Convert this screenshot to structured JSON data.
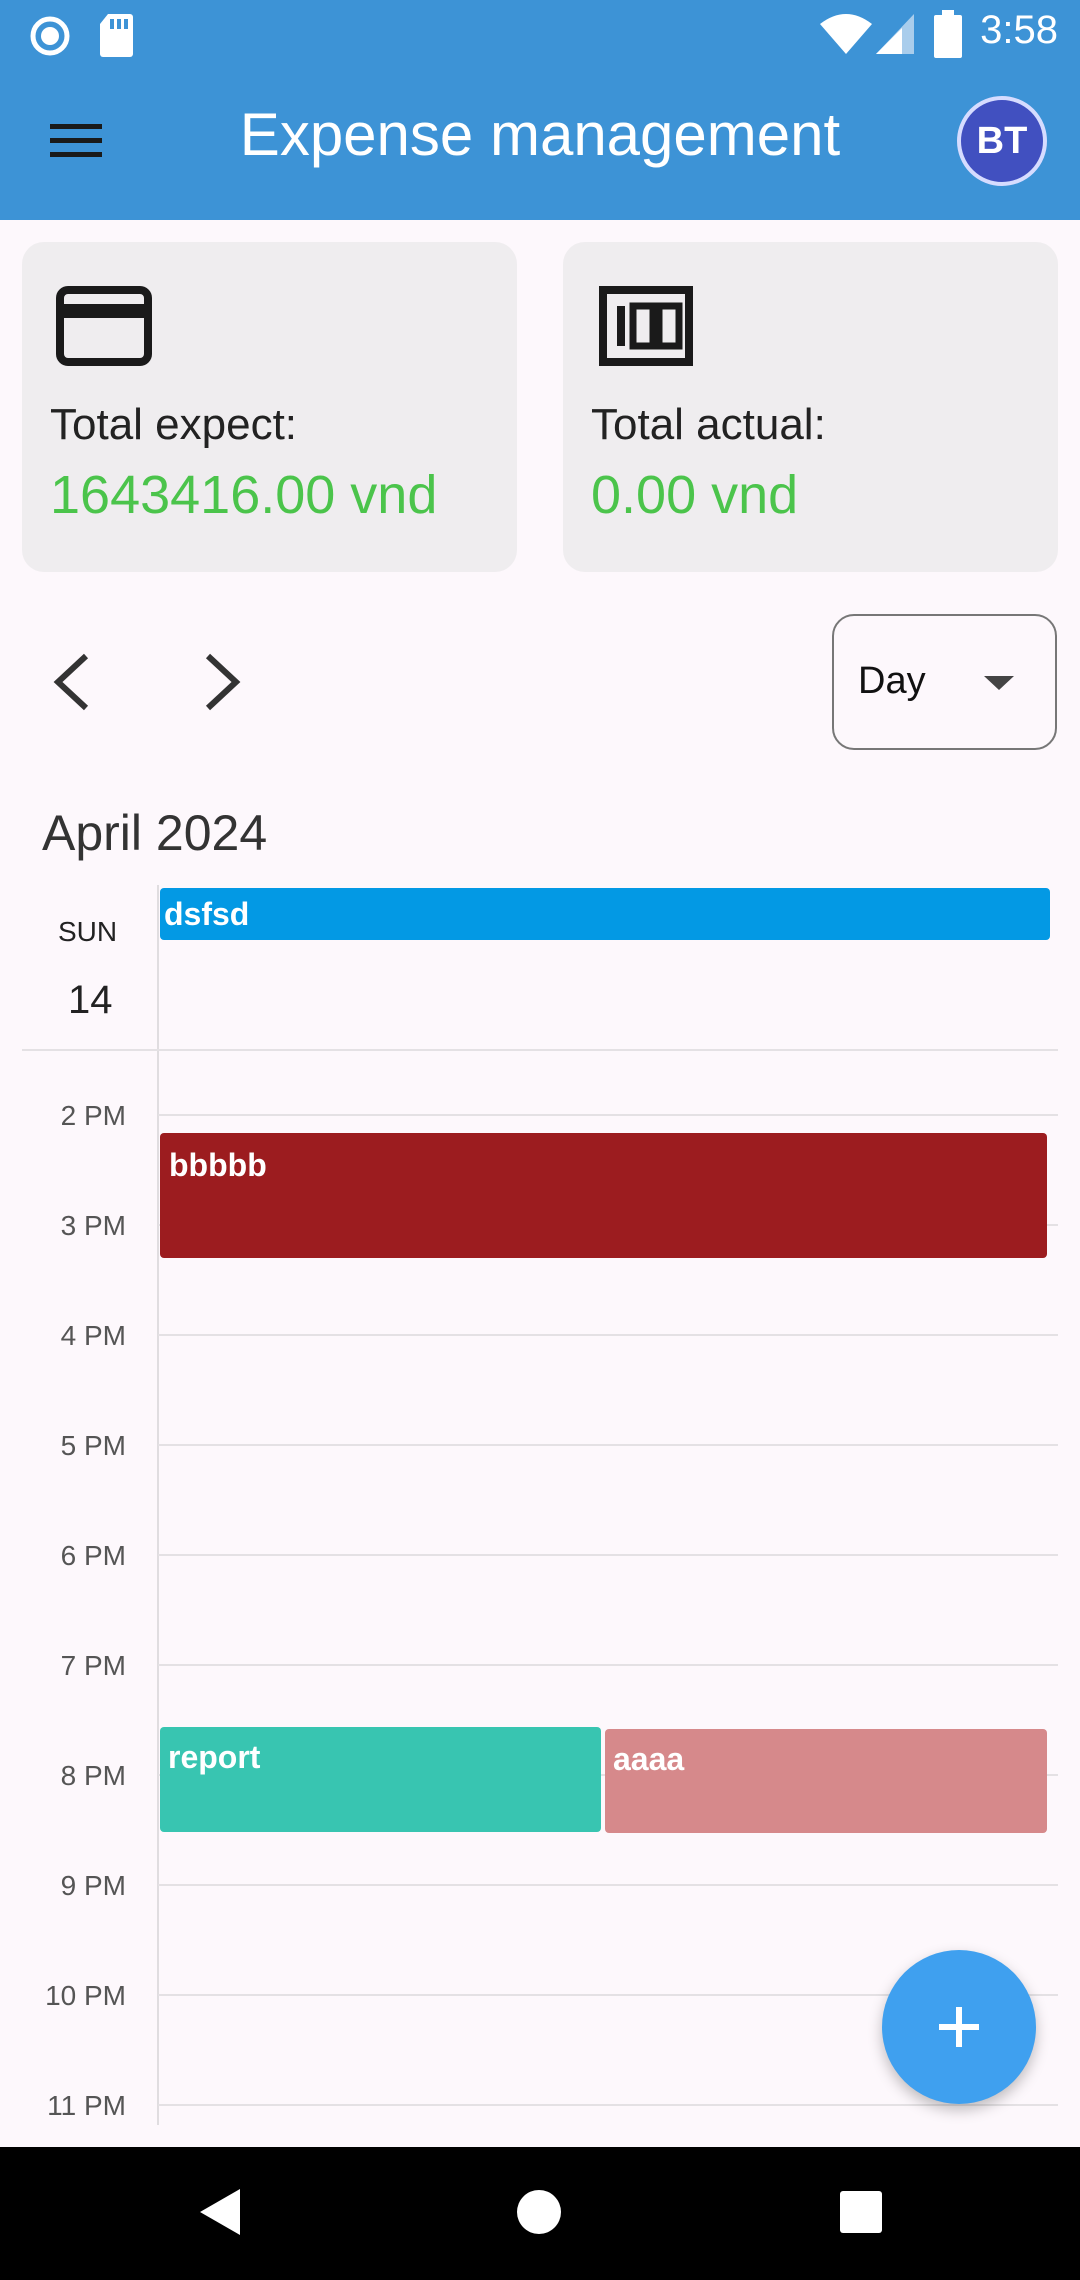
{
  "status_bar": {
    "time": "3:58"
  },
  "app_bar": {
    "title": "Expense management",
    "avatar_initials": "BT"
  },
  "summary": {
    "expect": {
      "label": "Total expect:",
      "value": "1643416.00 vnd",
      "icon": "credit-card-icon"
    },
    "actual": {
      "label": "Total actual:",
      "value": "0.00 vnd",
      "icon": "money-100-icon"
    },
    "value_color": "#4bc44b"
  },
  "view_selector": {
    "selected": "Day"
  },
  "calendar": {
    "month_label": "April 2024",
    "day_name": "SUN",
    "day_number": "14",
    "hours": [
      "2 PM",
      "3 PM",
      "4 PM",
      "5 PM",
      "6 PM",
      "7 PM",
      "8 PM",
      "9 PM",
      "10 PM",
      "11 PM"
    ],
    "events": [
      {
        "title": "dsfsd",
        "color": "#0399e4",
        "all_day": true
      },
      {
        "title": "bbbbb",
        "color": "#9c1c1f"
      },
      {
        "title": "report",
        "color": "#38c5b1"
      },
      {
        "title": "aaaa",
        "color": "#d6898b"
      }
    ]
  },
  "colors": {
    "app_bar": "#3d93d6",
    "fab": "#3fa0ef",
    "avatar": "#4150c0"
  }
}
